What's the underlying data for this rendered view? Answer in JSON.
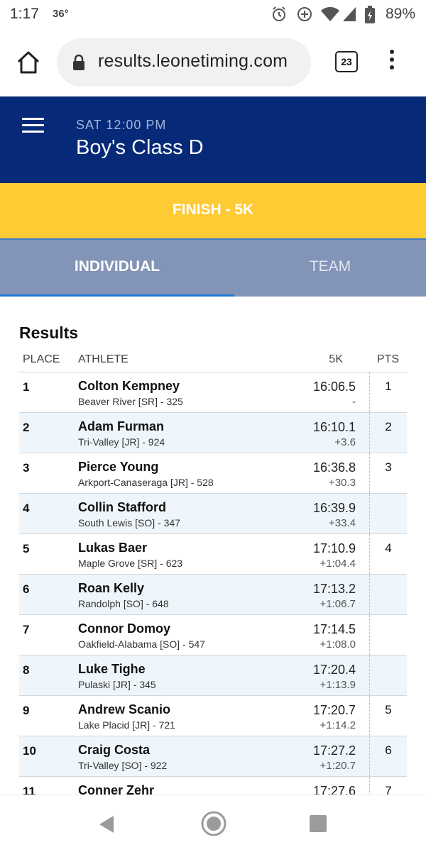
{
  "status_bar": {
    "time": "1:17",
    "temperature": "36°",
    "battery": "89%",
    "icons": [
      "alarm-icon",
      "data-saver-icon",
      "wifi-icon",
      "signal-icon",
      "battery-charging-icon"
    ]
  },
  "browser": {
    "url": "results.leonetiming.com",
    "tab_count": "23"
  },
  "header": {
    "event_time": "SAT 12:00 PM",
    "event_title": "Boy's Class D"
  },
  "finish_band": {
    "label": "FINISH - 5K"
  },
  "tabs": [
    {
      "label": "INDIVIDUAL",
      "active": true
    },
    {
      "label": "TEAM",
      "active": false
    }
  ],
  "results": {
    "heading": "Results",
    "columns": {
      "place": "PLACE",
      "athlete": "ATHLETE",
      "split": "5K",
      "points": "PTS"
    },
    "rows": [
      {
        "place": "1",
        "name": "Colton Kempney",
        "info": "Beaver River [SR] - 325",
        "time": "16:06.5",
        "gap": "-",
        "pts": "1"
      },
      {
        "place": "2",
        "name": "Adam Furman",
        "info": "Tri-Valley [JR] - 924",
        "time": "16:10.1",
        "gap": "+3.6",
        "pts": "2"
      },
      {
        "place": "3",
        "name": "Pierce Young",
        "info": "Arkport-Canaseraga [JR] - 528",
        "time": "16:36.8",
        "gap": "+30.3",
        "pts": "3"
      },
      {
        "place": "4",
        "name": "Collin Stafford",
        "info": "South Lewis [SO] - 347",
        "time": "16:39.9",
        "gap": "+33.4",
        "pts": ""
      },
      {
        "place": "5",
        "name": "Lukas Baer",
        "info": "Maple Grove [SR] - 623",
        "time": "17:10.9",
        "gap": "+1:04.4",
        "pts": "4"
      },
      {
        "place": "6",
        "name": "Roan Kelly",
        "info": "Randolph [SO] - 648",
        "time": "17:13.2",
        "gap": "+1:06.7",
        "pts": ""
      },
      {
        "place": "7",
        "name": "Connor Domoy",
        "info": "Oakfield-Alabama [SO] - 547",
        "time": "17:14.5",
        "gap": "+1:08.0",
        "pts": ""
      },
      {
        "place": "8",
        "name": "Luke Tighe",
        "info": "Pulaski [JR] - 345",
        "time": "17:20.4",
        "gap": "+1:13.9",
        "pts": ""
      },
      {
        "place": "9",
        "name": "Andrew Scanio",
        "info": "Lake Placid [JR] - 721",
        "time": "17:20.7",
        "gap": "+1:14.2",
        "pts": "5"
      },
      {
        "place": "10",
        "name": "Craig Costa",
        "info": "Tri-Valley [SO] - 922",
        "time": "17:27.2",
        "gap": "+1:20.7",
        "pts": "6"
      },
      {
        "place": "11",
        "name": "Conner Zehr",
        "info": "",
        "time": "17:27.6",
        "gap": "",
        "pts": "7"
      }
    ]
  },
  "colors": {
    "header_bg": "#062a78",
    "finish_band_bg": "#fecb35",
    "tabs_bg": "#8294b7",
    "tab_indicator": "#2278d3",
    "alt_row_bg": "#eef6fb"
  }
}
